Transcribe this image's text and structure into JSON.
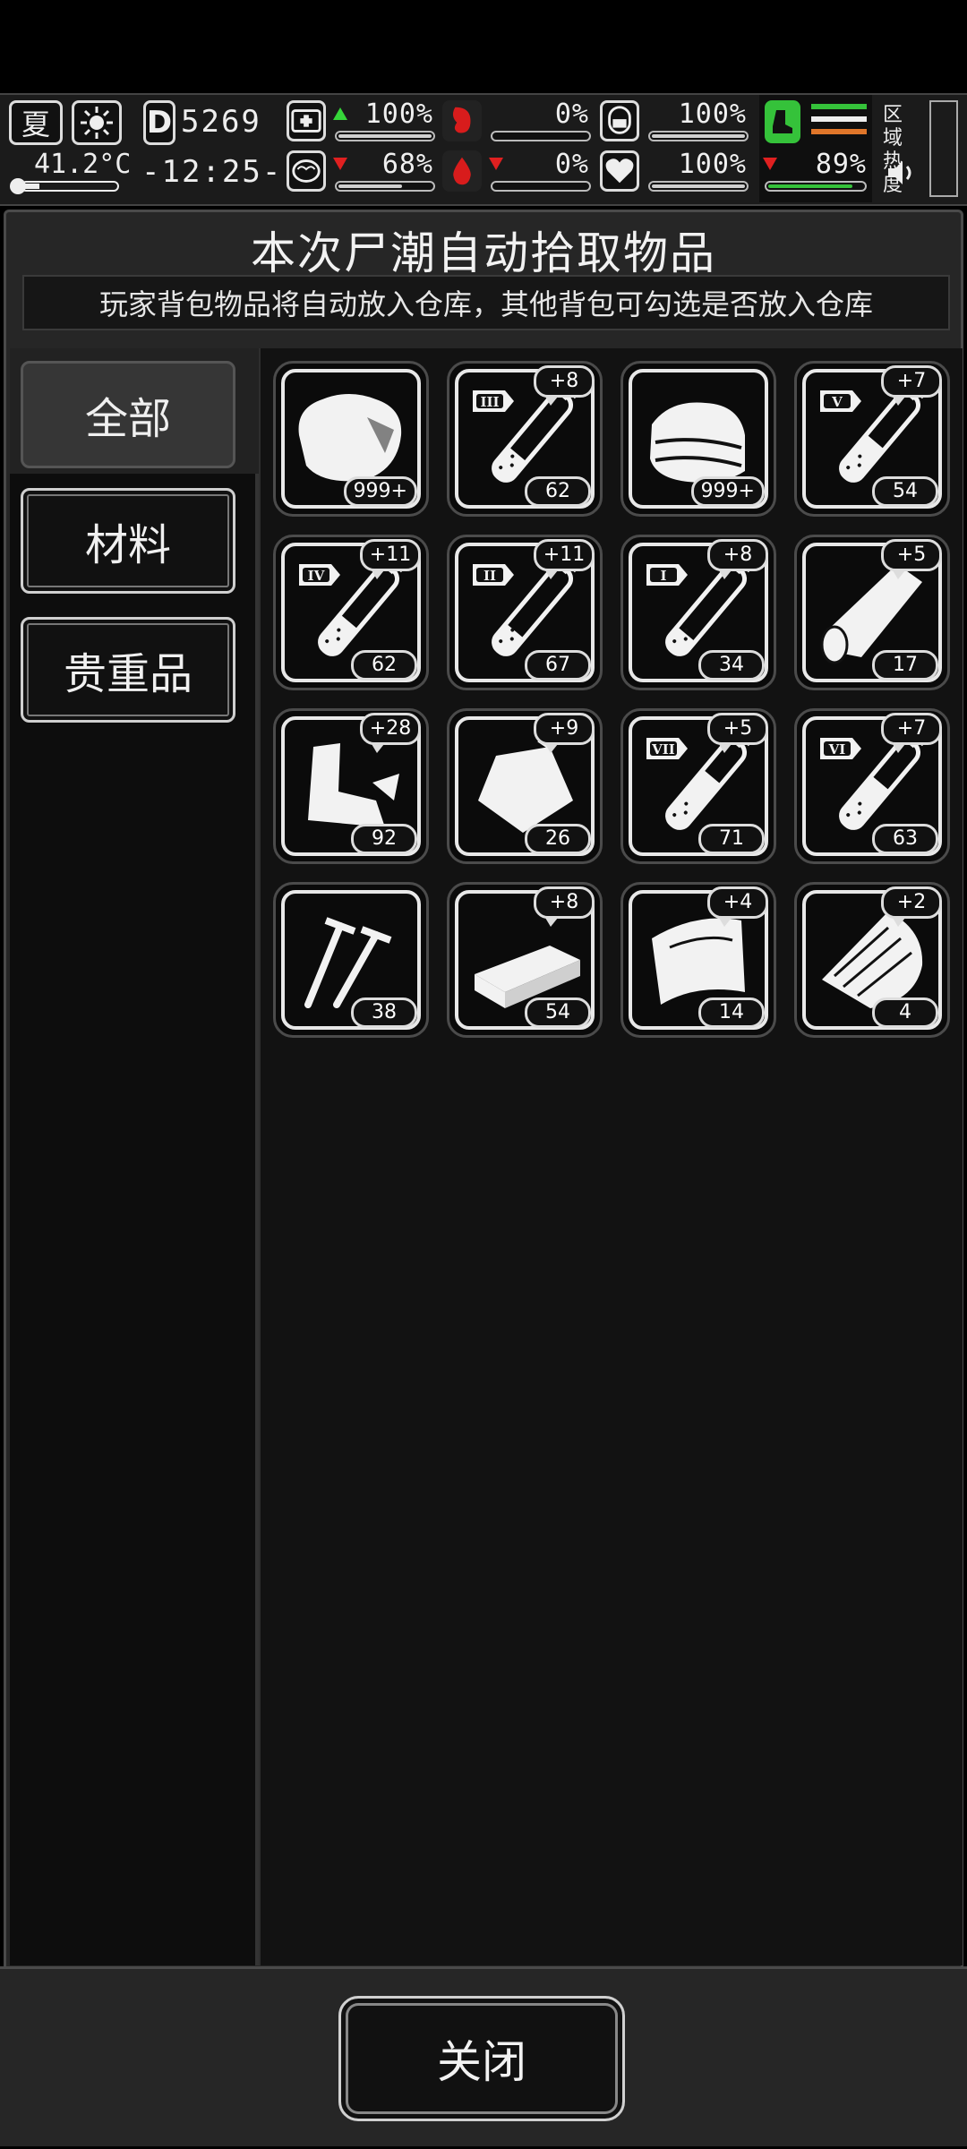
{
  "hud": {
    "season": "夏",
    "temperature": "41.2°C",
    "day_letter": "D",
    "day": "5269",
    "time": "-12:25-",
    "stats": [
      {
        "name": "health",
        "value": "100%",
        "trend": "up",
        "fill": 1.0,
        "color": "#cfcfcf"
      },
      {
        "name": "hunger",
        "value": "0%",
        "trend": "none",
        "fill": 0.0,
        "color": "#cfcfcf"
      },
      {
        "name": "shield",
        "value": "100%",
        "trend": "none",
        "fill": 1.0,
        "color": "#cfcfcf"
      },
      {
        "name": "brain",
        "value": "68%",
        "trend": "down",
        "fill": 0.68,
        "color": "#cfcfcf"
      },
      {
        "name": "blood",
        "value": "0%",
        "trend": "down",
        "fill": 0.0,
        "color": "#cfcfcf"
      },
      {
        "name": "heart",
        "value": "100%",
        "trend": "none",
        "fill": 1.0,
        "color": "#cfcfcf"
      }
    ],
    "stamina": {
      "value": "89%",
      "trend": "down",
      "fill": 0.89,
      "color": "#35c23a"
    },
    "zone_label": "区域热度"
  },
  "panel": {
    "title": "本次尸潮自动拾取物品",
    "subtitle": "玩家背包物品将自动放入仓库，其他背包可勾选是否放入仓库"
  },
  "tabs": [
    {
      "label": "全部",
      "active": true
    },
    {
      "label": "材料",
      "active": false
    },
    {
      "label": "贵重品",
      "active": false
    }
  ],
  "items": [
    {
      "icon": "rock-icon",
      "count": "999+",
      "plus": ""
    },
    {
      "icon": "vial-3-icon",
      "count": "62",
      "plus": "+8",
      "roman": "III",
      "level": 0.35
    },
    {
      "icon": "cloth-icon",
      "count": "999+",
      "plus": ""
    },
    {
      "icon": "vial-5-icon",
      "count": "54",
      "plus": "+7",
      "roman": "V",
      "level": 0.55
    },
    {
      "icon": "vial-4-icon",
      "count": "62",
      "plus": "+11",
      "roman": "IV",
      "level": 0.45
    },
    {
      "icon": "vial-2-icon",
      "count": "67",
      "plus": "+11",
      "roman": "II",
      "level": 0.3
    },
    {
      "icon": "vial-1-icon",
      "count": "34",
      "plus": "+8",
      "roman": "I",
      "level": 0.25
    },
    {
      "icon": "wood-log-icon",
      "count": "17",
      "plus": "+5"
    },
    {
      "icon": "scrap-metal-icon",
      "count": "92",
      "plus": "+28"
    },
    {
      "icon": "pouch-icon",
      "count": "26",
      "plus": "+9"
    },
    {
      "icon": "vial-7-icon",
      "count": "71",
      "plus": "+5",
      "roman": "VII",
      "level": 0.75
    },
    {
      "icon": "vial-6-icon",
      "count": "63",
      "plus": "+7",
      "roman": "VI",
      "level": 0.65
    },
    {
      "icon": "screws-icon",
      "count": "38",
      "plus": ""
    },
    {
      "icon": "plank-icon",
      "count": "54",
      "plus": "+8"
    },
    {
      "icon": "leather-icon",
      "count": "14",
      "plus": "+4"
    },
    {
      "icon": "bark-icon",
      "count": "4",
      "plus": "+2"
    }
  ],
  "footer": {
    "close_label": "关闭"
  }
}
